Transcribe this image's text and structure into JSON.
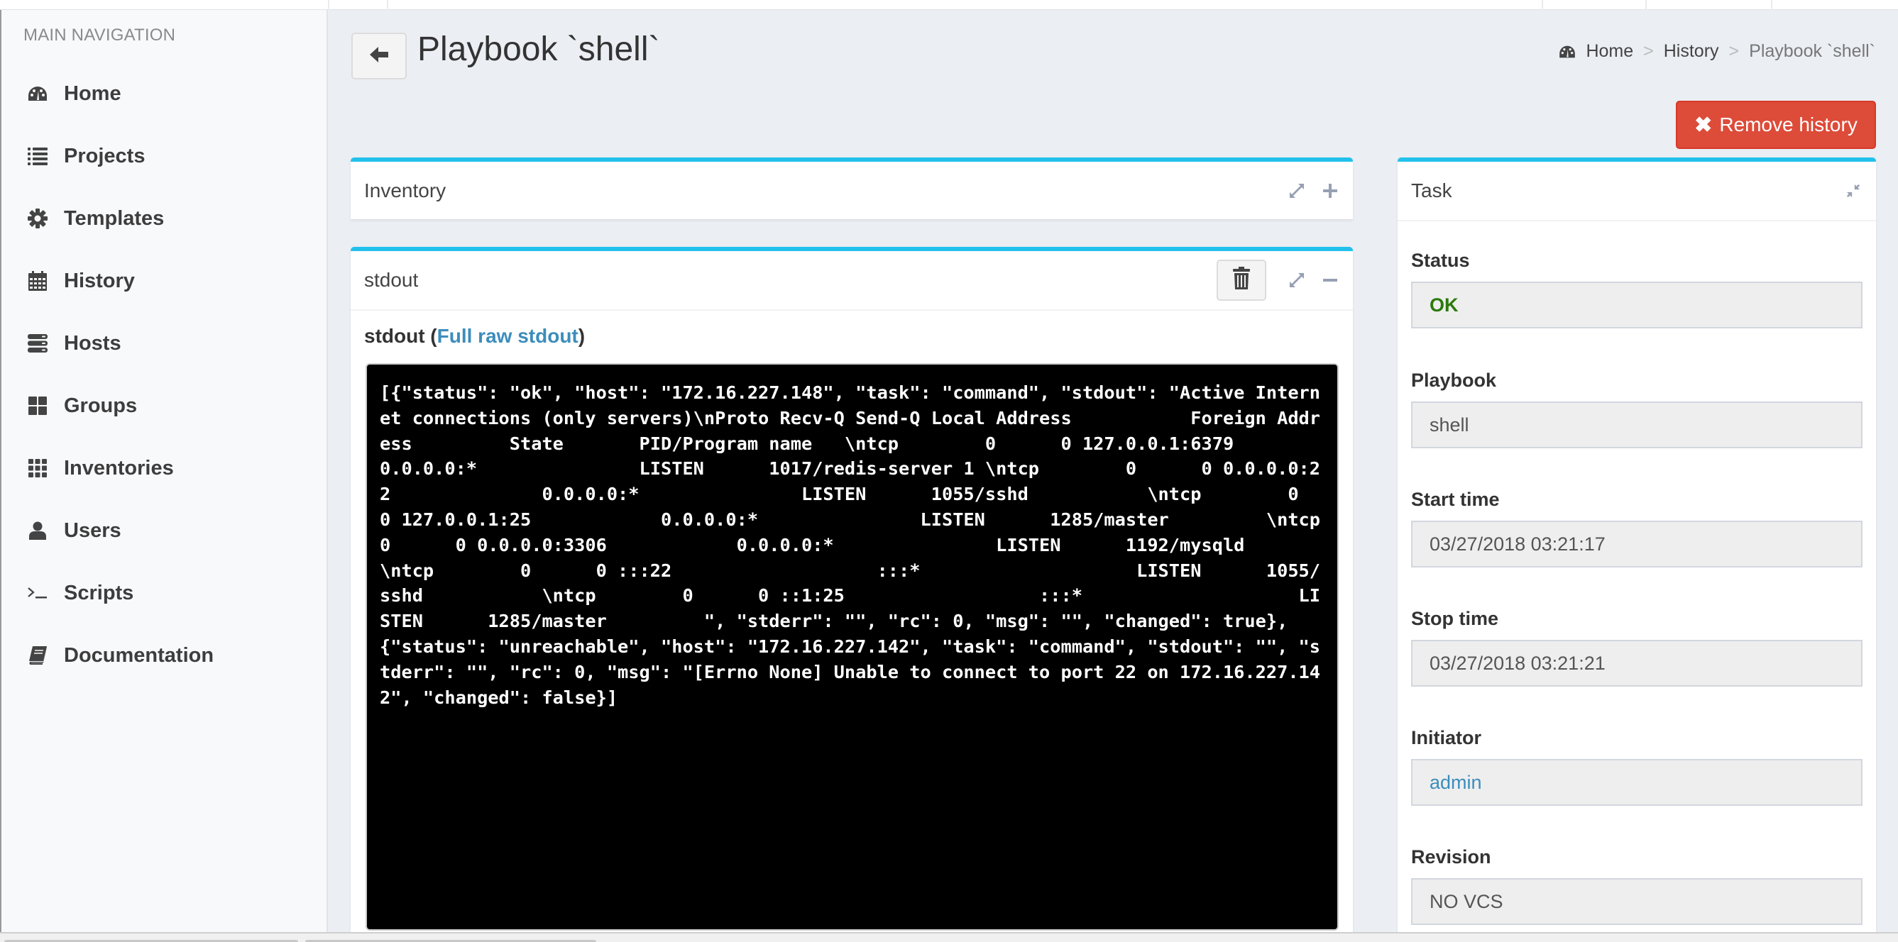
{
  "sidebar": {
    "header": "MAIN NAVIGATION",
    "items": [
      {
        "label": "Home",
        "icon": "dashboard-icon"
      },
      {
        "label": "Projects",
        "icon": "list-icon"
      },
      {
        "label": "Templates",
        "icon": "gear-icon"
      },
      {
        "label": "History",
        "icon": "calendar-icon"
      },
      {
        "label": "Hosts",
        "icon": "server-icon"
      },
      {
        "label": "Groups",
        "icon": "grid-large-icon"
      },
      {
        "label": "Inventories",
        "icon": "grid-small-icon"
      },
      {
        "label": "Users",
        "icon": "user-icon"
      },
      {
        "label": "Scripts",
        "icon": "terminal-icon"
      },
      {
        "label": "Documentation",
        "icon": "book-icon"
      }
    ]
  },
  "header": {
    "title": "Playbook `shell`",
    "back_icon": "arrow-left-icon",
    "breadcrumb": [
      {
        "label": "Home",
        "icon": "dashboard-icon"
      },
      {
        "label": "History"
      },
      {
        "label": "Playbook `shell`"
      }
    ],
    "breadcrumb_separator": ">"
  },
  "actions": {
    "remove_history": "Remove history"
  },
  "inventory_panel": {
    "title": "Inventory"
  },
  "stdout_panel": {
    "title": "stdout",
    "subtitle_prefix": "stdout (",
    "raw_link": "Full raw stdout",
    "subtitle_suffix": ")",
    "content": "[{\"status\": \"ok\", \"host\": \"172.16.227.148\", \"task\": \"command\", \"stdout\": \"Active Internet connections (only servers)\\nProto Recv-Q Send-Q Local Address           Foreign Address         State       PID/Program name   \\ntcp        0      0 127.0.0.1:6379          0.0.0.0:*               LISTEN      1017/redis-server 1 \\ntcp        0      0 0.0.0.0:22              0.0.0.0:*               LISTEN      1055/sshd           \\ntcp        0      0 127.0.0.1:25            0.0.0.0:*               LISTEN      1285/master         \\ntcp        0      0 0.0.0.0:3306            0.0.0.0:*               LISTEN      1192/mysqld         \\ntcp        0      0 :::22                   :::*                    LISTEN      1055/sshd           \\ntcp        0      0 ::1:25                  :::*                    LISTEN      1285/master         \", \"stderr\": \"\", \"rc\": 0, \"msg\": \"\", \"changed\": true}, {\"status\": \"unreachable\", \"host\": \"172.16.227.142\", \"task\": \"command\", \"stdout\": \"\", \"stderr\": \"\", \"rc\": 0, \"msg\": \"[Errno None] Unable to connect to port 22 on 172.16.227.142\", \"changed\": false}]"
  },
  "task_panel": {
    "title": "Task",
    "fields": [
      {
        "label": "Status",
        "value": "OK"
      },
      {
        "label": "Playbook",
        "value": "shell"
      },
      {
        "label": "Start time",
        "value": "03/27/2018 03:21:17"
      },
      {
        "label": "Stop time",
        "value": "03/27/2018 03:21:21"
      },
      {
        "label": "Initiator",
        "value": "admin"
      },
      {
        "label": "Revision",
        "value": "NO VCS"
      }
    ]
  },
  "colors": {
    "accent": "#22c1ec",
    "danger": "#dd4b39",
    "status_ok": "#2b7a0b",
    "link": "#3c8dbc"
  }
}
